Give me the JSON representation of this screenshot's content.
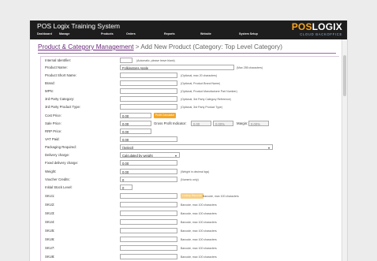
{
  "header": {
    "app_title": "POS Logix Training System",
    "nav": [
      "Dashboard",
      "Manage",
      "Products",
      "Orders",
      "Reports",
      "Website",
      "System Setup"
    ],
    "logo_pos": "POS",
    "logo_logix": "LOGIX",
    "logo_tagline": "CLOUD BACKOFFICE"
  },
  "breadcrumb": {
    "link": "Product & Category Management",
    "rest": " > Add New Product (Category: Top Level Category)"
  },
  "form": {
    "internal_identifier": {
      "label": "Internal Identifier:",
      "value": "",
      "hint": "(Automatic, please leave blank)"
    },
    "product_name": {
      "label": "Product Name:",
      "value": "Folkingtons Apple",
      "hint": "(Max 255 characters)"
    },
    "product_short_name": {
      "label": "Product Short Name:",
      "value": "",
      "hint": "(Optional, max 20 characters)"
    },
    "brand": {
      "label": "Brand:",
      "value": "",
      "hint": "(Optional, Product Brand Name)"
    },
    "mpn": {
      "label": "MPN:",
      "value": "",
      "hint": "(Optional, Product Manufacturer Part Number)"
    },
    "third_party_category": {
      "label": "3rd Party Category:",
      "value": "",
      "hint": "(Optional, 3rd Party Category Reference)"
    },
    "third_party_product_type": {
      "label": "3rd Party Product Type:",
      "value": "",
      "hint": "(Optional, 3rd Party Product Type)"
    },
    "cost_price": {
      "label": "Cost Price:",
      "value": "0.00",
      "button": "Profit Calculator"
    },
    "sale_price": {
      "label": "Sale Price:",
      "value": "0.00",
      "gp_label": "Gross Profit Indicator:",
      "gp_value": "0.00",
      "gp_percent": "0.00%",
      "margin_label": "Margin:",
      "margin_value": "0.00%"
    },
    "rrp_price": {
      "label": "RRP Price:",
      "value": "0.00"
    },
    "vat_paid": {
      "label": "VAT Paid:",
      "value": "0.00"
    },
    "packaging_required": {
      "label": "Packaging Required:",
      "value": "(Select)"
    },
    "delivery_charge": {
      "label": "Delivery charge:",
      "value": "Calculated by weight"
    },
    "fixed_delivery_charge": {
      "label": "Fixed delivery charge:",
      "value": "0.00"
    },
    "weight": {
      "label": "Weight:",
      "value": "0.00",
      "hint": "(Weight in decimal kgs)"
    },
    "voucher_credits": {
      "label": "Voucher Credits:",
      "value": "0",
      "hint": "(Numeric only)"
    },
    "initial_stock_level": {
      "label": "Initial Stock Level:",
      "value": "0"
    },
    "sku_button": "Lookup Barcode",
    "skus": [
      {
        "label": "SKU1:",
        "value": "",
        "hint": "Barcode, max 100 characters"
      },
      {
        "label": "SKU2:",
        "value": "",
        "hint": "Barcode, max 100 characters"
      },
      {
        "label": "SKU3:",
        "value": "",
        "hint": "Barcode, max 100 characters"
      },
      {
        "label": "SKU4:",
        "value": "",
        "hint": "Barcode, max 100 characters"
      },
      {
        "label": "SKU5:",
        "value": "",
        "hint": "Barcode, max 100 characters"
      },
      {
        "label": "SKU6:",
        "value": "",
        "hint": "Barcode, max 100 characters"
      },
      {
        "label": "SKU7:",
        "value": "",
        "hint": "Barcode, max 100 characters"
      },
      {
        "label": "SKU8:",
        "value": "",
        "hint": "Barcode, max 100 characters"
      }
    ]
  }
}
